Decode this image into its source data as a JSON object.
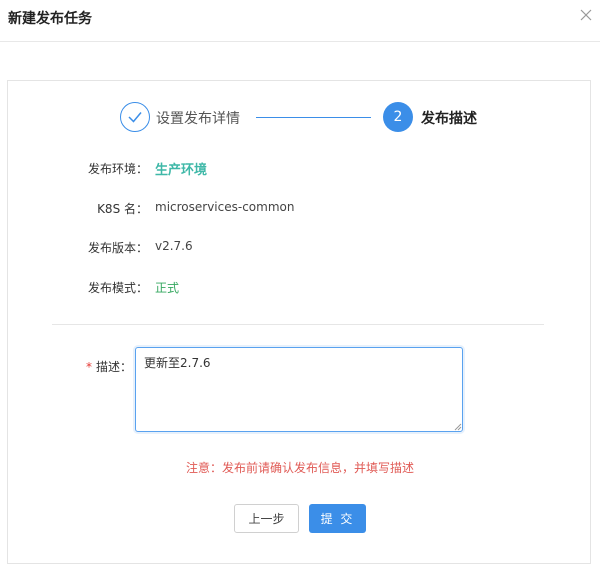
{
  "dialog": {
    "title": "新建发布任务",
    "close_icon": "close-icon"
  },
  "steps": [
    {
      "index": "1",
      "label": "设置发布详情",
      "status": "finished",
      "icon": "check-icon"
    },
    {
      "index": "2",
      "label": "发布描述",
      "status": "active"
    }
  ],
  "info": {
    "env_label": "发布环境：",
    "env_value": "生产环境",
    "k8s_label": "K8S 名：",
    "k8s_value": "microservices-common",
    "version_label": "发布版本：",
    "version_value": "v2.7.6",
    "mode_label": "发布模式：",
    "mode_value": "正式"
  },
  "form": {
    "required_mark": "*",
    "desc_label": "描述：",
    "desc_value": "更新至2.7.6"
  },
  "notice": "注意：发布前请确认发布信息，并填写描述",
  "buttons": {
    "prev": "上一步",
    "submit": "提 交"
  },
  "colors": {
    "primary": "#3b8ee8",
    "env_value": "#3fb8a8",
    "mode_value": "#36a860",
    "notice": "#e05a55",
    "required": "#e53935"
  }
}
